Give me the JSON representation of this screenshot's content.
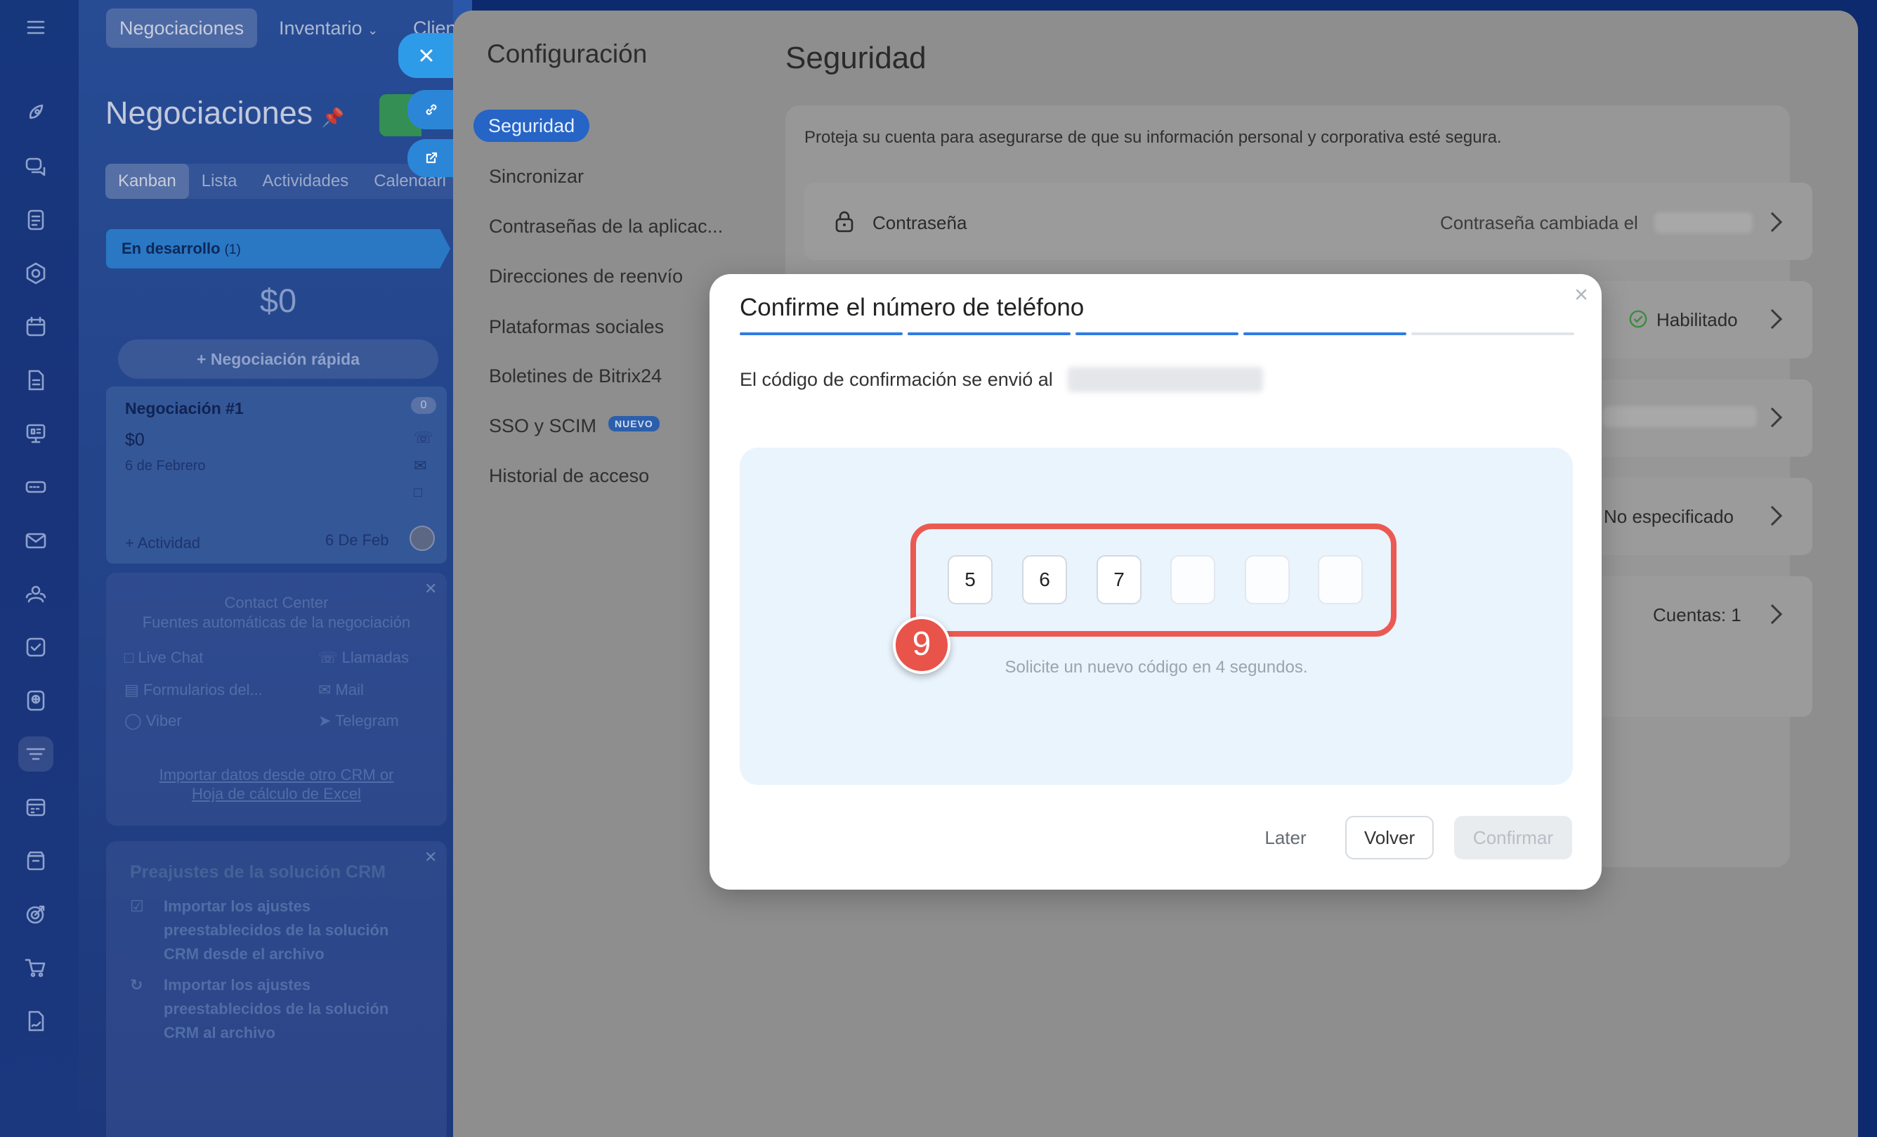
{
  "left_rail": {
    "icons": [
      "menu-icon",
      "rocket-icon",
      "chat-icon",
      "feed-icon",
      "hexagon-icon",
      "calendar-icon",
      "document-icon",
      "board-icon",
      "server-icon",
      "mail-icon",
      "contacts-icon",
      "task-icon",
      "apps-icon",
      "crm-funnel-icon",
      "timetable-icon",
      "box-icon",
      "target-icon",
      "cart-icon",
      "doc-sign-icon"
    ]
  },
  "crm": {
    "nav": {
      "deals": "Negociaciones",
      "inventory": "Inventario",
      "clients": "Clien"
    },
    "page_title": "Negociaciones",
    "view_tabs": [
      "Kanban",
      "Lista",
      "Actividades",
      "Calendari"
    ],
    "stage": {
      "name": "En desarrollo",
      "count": "(1)",
      "sum": "$0"
    },
    "quick_deal": "Negociación rápida",
    "deal_card": {
      "title": "Negociación #1",
      "amount": "$0",
      "date": "6 de Febrero",
      "badge": "0",
      "activity": "+ Actividad",
      "due": "6 De Feb"
    },
    "contact_center": {
      "title": "Contact Center",
      "subtitle": "Fuentes automáticas de la negociación",
      "sources": [
        "Live Chat",
        "Llamadas",
        "Formularios del...",
        "Mail",
        "Viber",
        "Telegram"
      ],
      "import_line1": "Importar datos desde otro CRM or",
      "import_line2": "Hoja de cálculo de Excel"
    },
    "presets": {
      "title": "Preajustes de la solución CRM",
      "item1": [
        "Importar los ajustes",
        "preestablecidos de la solución",
        "CRM desde el archivo"
      ],
      "item2": [
        "Importar los ajustes",
        "preestablecidos de la solución",
        "CRM al archivo"
      ]
    }
  },
  "settings": {
    "title": "Configuración",
    "menu": [
      "Seguridad",
      "Sincronizar",
      "Contraseñas de la aplicac...",
      "Direcciones de reenvío",
      "Plataformas sociales",
      "Boletines de Bitrix24",
      "SSO y SCIM",
      "Historial de acceso"
    ],
    "new_badge": "NUEVO",
    "section_title": "Seguridad",
    "description": "Proteja su cuenta para asegurarse de que su información personal y corporativa esté segura.",
    "rows": {
      "password_label": "Contraseña",
      "password_status": "Contraseña cambiada el",
      "twofa_status": "Habilitado",
      "unspecified": "No especificado",
      "accounts": "Cuentas: 1"
    }
  },
  "modal": {
    "title": "Confirme el número de teléfono",
    "progress_steps_done": 4,
    "progress_steps_total": 5,
    "sent_text": "El código de confirmación se envió al",
    "code_digits": [
      "5",
      "6",
      "7",
      "",
      "",
      ""
    ],
    "step_number": "9",
    "resend_text": "Solicite un nuevo código en 4 segundos.",
    "buttons": {
      "later": "Later",
      "back": "Volver",
      "confirm": "Confirmar"
    }
  },
  "colors": {
    "accent": "#2f7be6",
    "highlight": "#eb5a52",
    "progress_done": "#2f7be6",
    "progress_todo": "#e1e4e8"
  }
}
